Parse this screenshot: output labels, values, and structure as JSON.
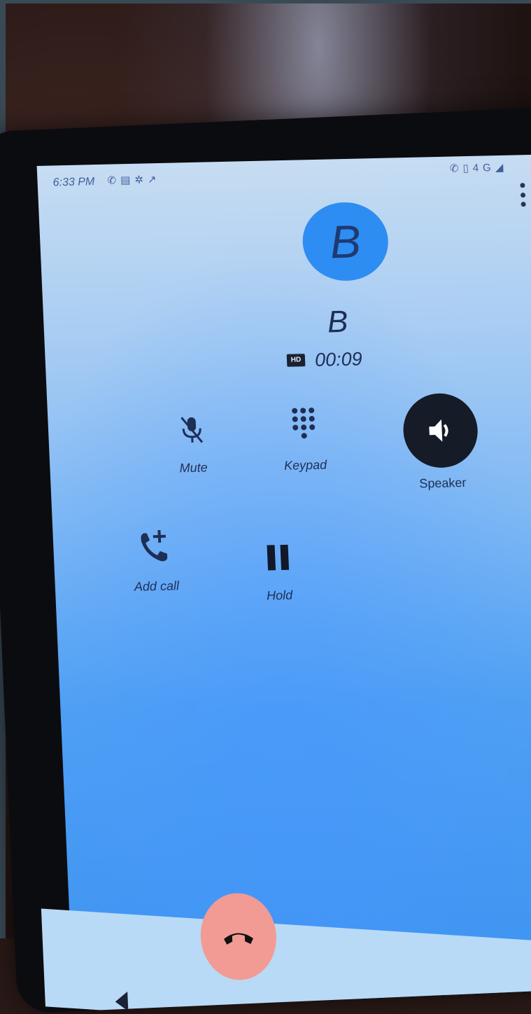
{
  "status_bar": {
    "time": "6:33 PM",
    "left_icons": [
      "phone-icon",
      "message-icon",
      "settings-icon",
      "missed-call-icon"
    ],
    "right_icons": [
      "call-icon",
      "vibrate-icon",
      "network-icon",
      "signal-icon"
    ],
    "network_label": "4G"
  },
  "call": {
    "avatar_letter": "B",
    "contact_name": "B",
    "hd_label": "HD",
    "timer": "00:09"
  },
  "controls": {
    "mute": "Mute",
    "keypad": "Keypad",
    "speaker": "Speaker",
    "add_call": "Add call",
    "hold": "Hold"
  },
  "colors": {
    "avatar": "#2e8df2",
    "end_call": "#f29b94",
    "speaker_active": "#161b28"
  }
}
